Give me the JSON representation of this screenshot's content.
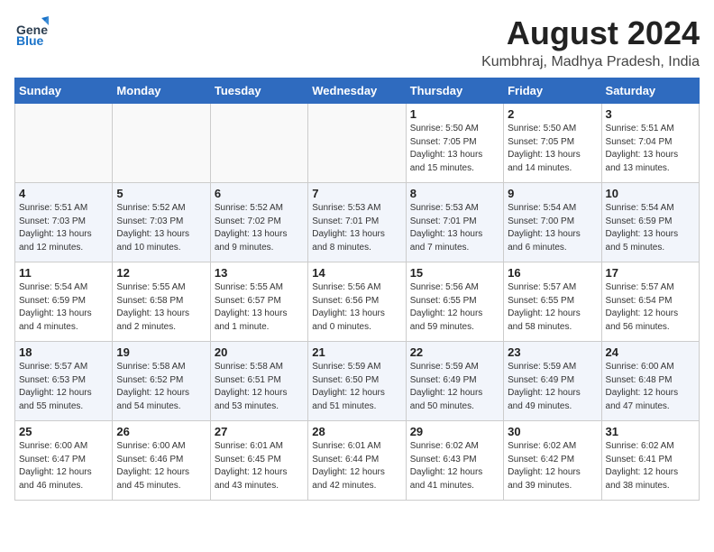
{
  "header": {
    "logo_line1": "General",
    "logo_line2": "Blue",
    "month_title": "August 2024",
    "location": "Kumbhraj, Madhya Pradesh, India"
  },
  "days_of_week": [
    "Sunday",
    "Monday",
    "Tuesday",
    "Wednesday",
    "Thursday",
    "Friday",
    "Saturday"
  ],
  "weeks": [
    [
      {
        "day": "",
        "info": ""
      },
      {
        "day": "",
        "info": ""
      },
      {
        "day": "",
        "info": ""
      },
      {
        "day": "",
        "info": ""
      },
      {
        "day": "1",
        "info": "Sunrise: 5:50 AM\nSunset: 7:05 PM\nDaylight: 13 hours\nand 15 minutes."
      },
      {
        "day": "2",
        "info": "Sunrise: 5:50 AM\nSunset: 7:05 PM\nDaylight: 13 hours\nand 14 minutes."
      },
      {
        "day": "3",
        "info": "Sunrise: 5:51 AM\nSunset: 7:04 PM\nDaylight: 13 hours\nand 13 minutes."
      }
    ],
    [
      {
        "day": "4",
        "info": "Sunrise: 5:51 AM\nSunset: 7:03 PM\nDaylight: 13 hours\nand 12 minutes."
      },
      {
        "day": "5",
        "info": "Sunrise: 5:52 AM\nSunset: 7:03 PM\nDaylight: 13 hours\nand 10 minutes."
      },
      {
        "day": "6",
        "info": "Sunrise: 5:52 AM\nSunset: 7:02 PM\nDaylight: 13 hours\nand 9 minutes."
      },
      {
        "day": "7",
        "info": "Sunrise: 5:53 AM\nSunset: 7:01 PM\nDaylight: 13 hours\nand 8 minutes."
      },
      {
        "day": "8",
        "info": "Sunrise: 5:53 AM\nSunset: 7:01 PM\nDaylight: 13 hours\nand 7 minutes."
      },
      {
        "day": "9",
        "info": "Sunrise: 5:54 AM\nSunset: 7:00 PM\nDaylight: 13 hours\nand 6 minutes."
      },
      {
        "day": "10",
        "info": "Sunrise: 5:54 AM\nSunset: 6:59 PM\nDaylight: 13 hours\nand 5 minutes."
      }
    ],
    [
      {
        "day": "11",
        "info": "Sunrise: 5:54 AM\nSunset: 6:59 PM\nDaylight: 13 hours\nand 4 minutes."
      },
      {
        "day": "12",
        "info": "Sunrise: 5:55 AM\nSunset: 6:58 PM\nDaylight: 13 hours\nand 2 minutes."
      },
      {
        "day": "13",
        "info": "Sunrise: 5:55 AM\nSunset: 6:57 PM\nDaylight: 13 hours\nand 1 minute."
      },
      {
        "day": "14",
        "info": "Sunrise: 5:56 AM\nSunset: 6:56 PM\nDaylight: 13 hours\nand 0 minutes."
      },
      {
        "day": "15",
        "info": "Sunrise: 5:56 AM\nSunset: 6:55 PM\nDaylight: 12 hours\nand 59 minutes."
      },
      {
        "day": "16",
        "info": "Sunrise: 5:57 AM\nSunset: 6:55 PM\nDaylight: 12 hours\nand 58 minutes."
      },
      {
        "day": "17",
        "info": "Sunrise: 5:57 AM\nSunset: 6:54 PM\nDaylight: 12 hours\nand 56 minutes."
      }
    ],
    [
      {
        "day": "18",
        "info": "Sunrise: 5:57 AM\nSunset: 6:53 PM\nDaylight: 12 hours\nand 55 minutes."
      },
      {
        "day": "19",
        "info": "Sunrise: 5:58 AM\nSunset: 6:52 PM\nDaylight: 12 hours\nand 54 minutes."
      },
      {
        "day": "20",
        "info": "Sunrise: 5:58 AM\nSunset: 6:51 PM\nDaylight: 12 hours\nand 53 minutes."
      },
      {
        "day": "21",
        "info": "Sunrise: 5:59 AM\nSunset: 6:50 PM\nDaylight: 12 hours\nand 51 minutes."
      },
      {
        "day": "22",
        "info": "Sunrise: 5:59 AM\nSunset: 6:49 PM\nDaylight: 12 hours\nand 50 minutes."
      },
      {
        "day": "23",
        "info": "Sunrise: 5:59 AM\nSunset: 6:49 PM\nDaylight: 12 hours\nand 49 minutes."
      },
      {
        "day": "24",
        "info": "Sunrise: 6:00 AM\nSunset: 6:48 PM\nDaylight: 12 hours\nand 47 minutes."
      }
    ],
    [
      {
        "day": "25",
        "info": "Sunrise: 6:00 AM\nSunset: 6:47 PM\nDaylight: 12 hours\nand 46 minutes."
      },
      {
        "day": "26",
        "info": "Sunrise: 6:00 AM\nSunset: 6:46 PM\nDaylight: 12 hours\nand 45 minutes."
      },
      {
        "day": "27",
        "info": "Sunrise: 6:01 AM\nSunset: 6:45 PM\nDaylight: 12 hours\nand 43 minutes."
      },
      {
        "day": "28",
        "info": "Sunrise: 6:01 AM\nSunset: 6:44 PM\nDaylight: 12 hours\nand 42 minutes."
      },
      {
        "day": "29",
        "info": "Sunrise: 6:02 AM\nSunset: 6:43 PM\nDaylight: 12 hours\nand 41 minutes."
      },
      {
        "day": "30",
        "info": "Sunrise: 6:02 AM\nSunset: 6:42 PM\nDaylight: 12 hours\nand 39 minutes."
      },
      {
        "day": "31",
        "info": "Sunrise: 6:02 AM\nSunset: 6:41 PM\nDaylight: 12 hours\nand 38 minutes."
      }
    ]
  ]
}
